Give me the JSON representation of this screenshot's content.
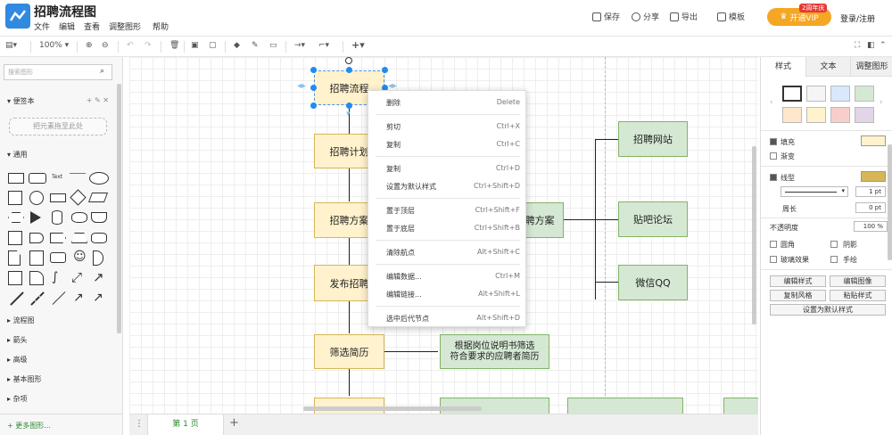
{
  "app": {
    "title": "招聘流程图"
  },
  "menu": [
    "文件",
    "编辑",
    "查看",
    "调整图形",
    "帮助"
  ],
  "header_actions": {
    "save": "保存",
    "share": "分享",
    "export": "导出",
    "template": "模板",
    "vip": "开通VIP",
    "vip_badge": "2周年庆",
    "login": "登录/注册"
  },
  "toolbar": {
    "zoom": "100%"
  },
  "sidebar": {
    "search_placeholder": "搜索图形",
    "scratchpad": "便签本",
    "drop_hint": "把元素拖至此处",
    "general": "通用",
    "text_shape": "Text",
    "categories": [
      "流程图",
      "箭头",
      "高级",
      "基本图形",
      "杂项"
    ],
    "more_shapes": "+ 更多图形..."
  },
  "canvas": {
    "nodes": {
      "n1": "招聘流程",
      "n2": "招聘计划",
      "n3": "招聘方案",
      "n4": "发布招聘",
      "n5": "筛选简历",
      "g1": "招聘方案",
      "g2": "招聘网站",
      "g3": "贴吧论坛",
      "g4": "微信QQ",
      "g5_line1": "根据岗位说明书筛选",
      "g5_line2": "符合要求的应聘者简历"
    }
  },
  "context_menu": [
    {
      "label": "删除",
      "shortcut": "Delete"
    },
    {
      "label": "剪切",
      "shortcut": "Ctrl+X"
    },
    {
      "label": "复制",
      "shortcut": "Ctrl+C"
    },
    {
      "label": "复制",
      "shortcut": "Ctrl+D"
    },
    {
      "label": "设置为默认样式",
      "shortcut": "Ctrl+Shift+D"
    },
    {
      "label": "置于顶层",
      "shortcut": "Ctrl+Shift+F"
    },
    {
      "label": "置于底层",
      "shortcut": "Ctrl+Shift+B"
    },
    {
      "label": "清除航点",
      "shortcut": "Alt+Shift+C"
    },
    {
      "label": "编辑数据...",
      "shortcut": "Ctrl+M"
    },
    {
      "label": "编辑链接...",
      "shortcut": "Alt+Shift+L"
    },
    {
      "label": "选中后代节点",
      "shortcut": "Alt+Shift+D"
    }
  ],
  "bottom": {
    "page_tab": "第 1 页",
    "add": "+"
  },
  "right_panel": {
    "tabs": [
      "样式",
      "文本",
      "调整图形"
    ],
    "fill": "填充",
    "gradient": "渐变",
    "line": "线型",
    "perimeter": "周长",
    "line_width": "1 pt",
    "perimeter_value": "0 pt",
    "opacity": "不透明度",
    "opacity_value": "100 %",
    "rounded": "圆角",
    "shadow": "阴影",
    "glass": "玻璃效果",
    "sketch": "手绘",
    "buttons": [
      "编辑样式",
      "编辑图像",
      "复制风格",
      "粘贴样式",
      "设置为默认样式"
    ],
    "swatch_colors": [
      "#ffffff",
      "#f5f5f5",
      "#dae8fc",
      "#d5e8d4",
      "#ffe6cc",
      "#fff2cc",
      "#f8cecc",
      "#e1d5e7"
    ],
    "fill_color": "#fff2cc",
    "line_color": "#d6b656"
  }
}
